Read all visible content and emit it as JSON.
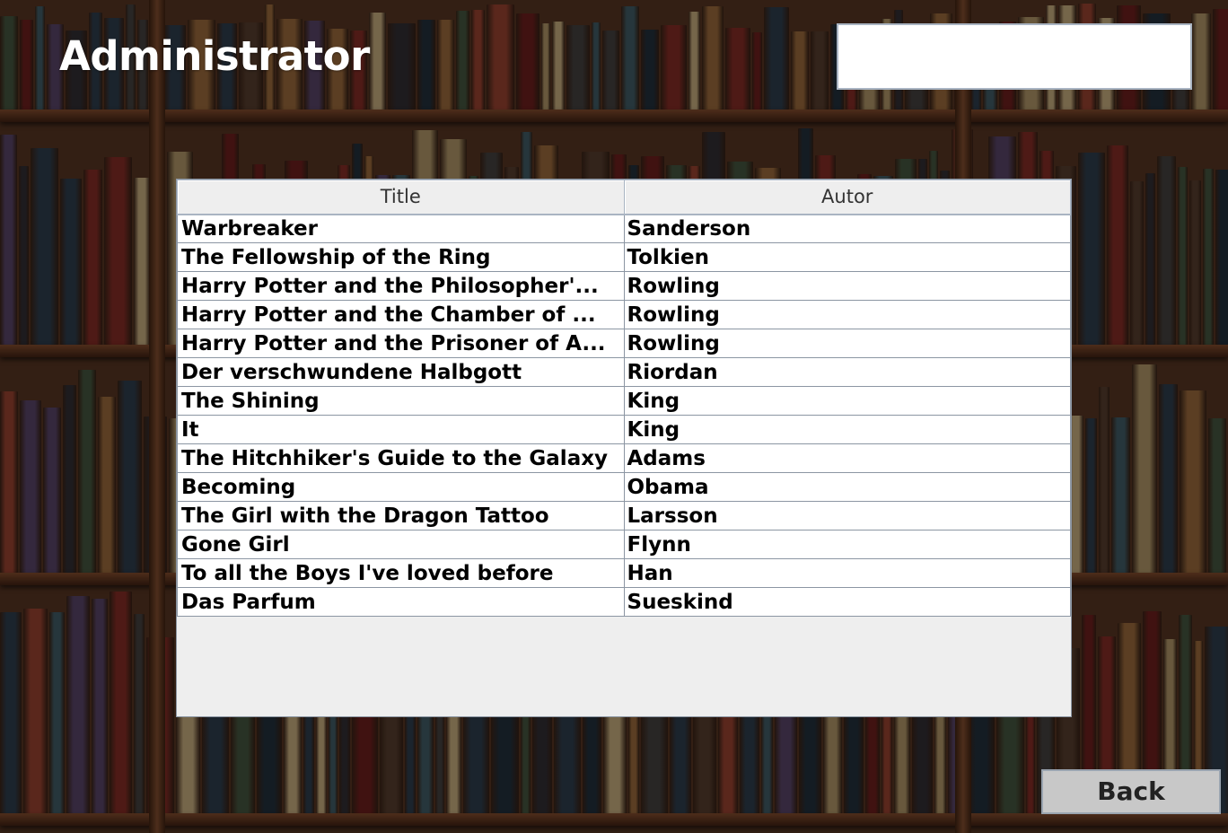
{
  "header": {
    "title": "Administrator",
    "input_value": ""
  },
  "table": {
    "columns": [
      "Title",
      "Autor"
    ],
    "rows": [
      {
        "title": "Warbreaker",
        "autor": "Sanderson"
      },
      {
        "title": "The Fellowship of the Ring",
        "autor": "Tolkien"
      },
      {
        "title": "Harry Potter and the Philosopher'...",
        "autor": "Rowling"
      },
      {
        "title": "Harry Potter and the Chamber of ...",
        "autor": "Rowling"
      },
      {
        "title": "Harry Potter and the Prisoner of A...",
        "autor": "Rowling"
      },
      {
        "title": "Der verschwundene Halbgott",
        "autor": "Riordan"
      },
      {
        "title": "The Shining",
        "autor": "King"
      },
      {
        "title": "It",
        "autor": "King"
      },
      {
        "title": "The Hitchhiker's Guide to the Galaxy",
        "autor": "Adams"
      },
      {
        "title": "Becoming",
        "autor": "Obama"
      },
      {
        "title": "The Girl with the Dragon Tattoo",
        "autor": "Larsson"
      },
      {
        "title": "Gone Girl",
        "autor": "Flynn"
      },
      {
        "title": "To all the Boys I've loved before",
        "autor": "Han"
      },
      {
        "title": "Das Parfum",
        "autor": "Sueskind"
      }
    ]
  },
  "footer": {
    "back_label": "Back"
  }
}
